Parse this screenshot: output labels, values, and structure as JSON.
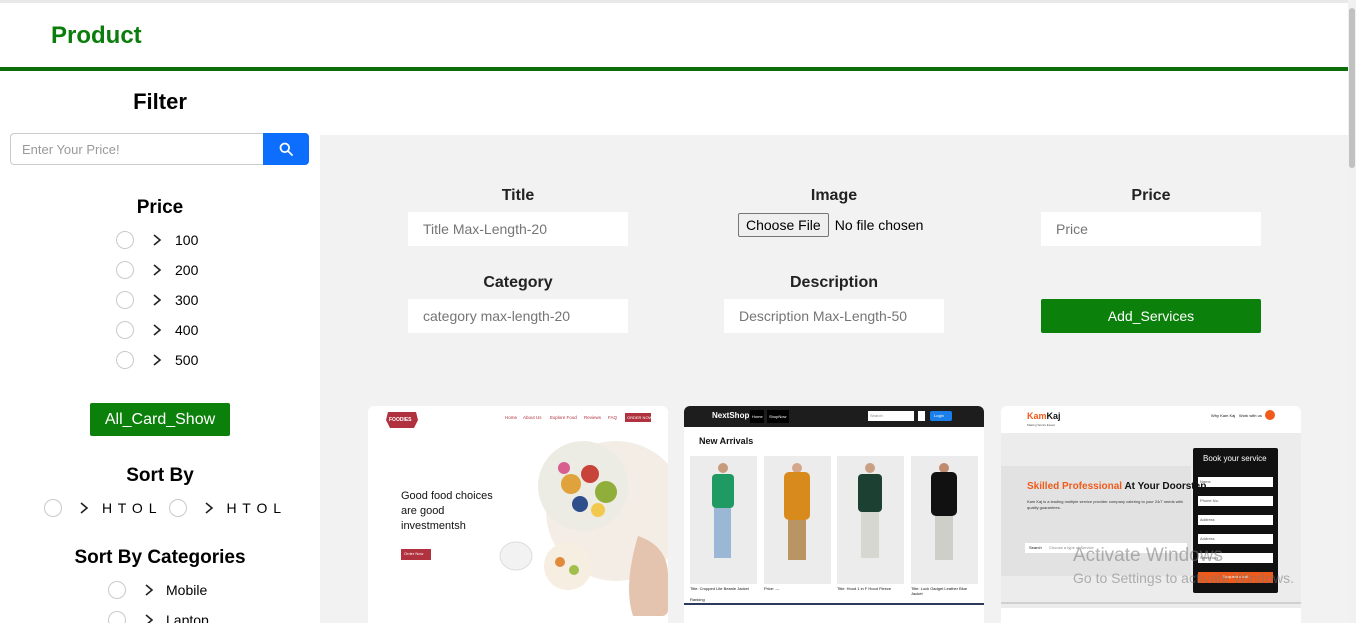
{
  "header": {
    "brand": "Product"
  },
  "sidebar": {
    "filter_title": "Filter",
    "search_placeholder": "Enter Your Price!",
    "price_title": "Price",
    "price_options": [
      "100",
      "200",
      "300",
      "400",
      "500"
    ],
    "all_card_button": "All_Card_Show",
    "sort_title": "Sort By",
    "sort_options": [
      "H T O L",
      "H T O L"
    ],
    "categories_title": "Sort By Categories",
    "categories": [
      "Mobile",
      "Laptop"
    ]
  },
  "form": {
    "title_label": "Title",
    "title_placeholder": "Title Max-Length-20",
    "image_label": "Image",
    "choose_file": "Choose File",
    "no_file": "No file chosen",
    "price_label": "Price",
    "price_placeholder": "Price",
    "category_label": "Category",
    "category_placeholder": "category max-length-20",
    "description_label": "Description",
    "description_placeholder": "Description Max-Length-50",
    "add_button": "Add_Services"
  },
  "cards": {
    "foodies": {
      "logo": "FOODIES",
      "nav": [
        "Home",
        "About Us",
        "Explore Food",
        "Reviews",
        "FAQ"
      ],
      "nav_btn": "ORDER NOW",
      "headline": "Good food choices are good investmentsh",
      "cta": "Order Now"
    },
    "nextshop": {
      "logo": "NextShop",
      "nav": [
        "Home",
        "ShopNow"
      ],
      "search": "Search",
      "login": "Login",
      "heading": "New Arrivals",
      "items": [
        "Title: Cropped Lite Beanie Jacket",
        "Price: ---",
        "Title: Hood 1 in F Hood Fleece",
        "Title: Lock Gadget Leather Blue Jacket"
      ],
      "rating": "Ranking"
    },
    "kamkaj": {
      "logo_a": "Kam",
      "logo_b": "Kaj",
      "tagline": "Making Works Easier",
      "nav": [
        "Why Kam Kaj",
        "Work with us"
      ],
      "headline_a": "Skilled Professional",
      "headline_b": " At Your Doorstep.",
      "body": "Kam Kaj is a leading multiple service provider company catering to your 24/7 needs with quality guarantees.",
      "search_label": "Search",
      "search_placeholder": "Choose a type of Service",
      "book_title": "Book your service",
      "book_fields": [
        "Name",
        "Phone No.",
        "Address",
        "Address",
        "Select city"
      ],
      "book_btn": "Request a call"
    }
  },
  "watermark": {
    "line1": "Activate Windows",
    "line2": "Go to Settings to activate Windows."
  },
  "colors": {
    "brand_green": "#0b7d0b",
    "button_green": "#0b800b",
    "search_blue": "#0d6efd",
    "panel_bg": "#f2f2f2"
  }
}
